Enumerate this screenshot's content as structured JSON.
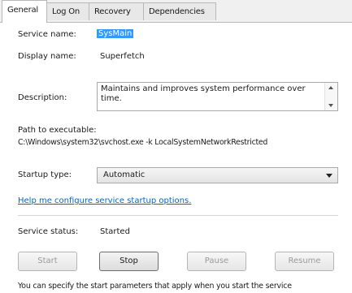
{
  "tabs": [
    "General",
    "Log On",
    "Recovery",
    "Dependencies"
  ],
  "service_name": {
    "label": "Service name:",
    "value": "SysMain"
  },
  "display_name": {
    "label": "Display name:",
    "value": "Superfetch"
  },
  "description": {
    "label": "Description:",
    "value": "Maintains and improves system performance over time."
  },
  "path": {
    "label": "Path to executable:",
    "value": "C:\\Windows\\system32\\svchost.exe -k LocalSystemNetworkRestricted"
  },
  "startup_type": {
    "label": "Startup type:",
    "value": "Automatic"
  },
  "help_link": "Help me configure service startup options.",
  "service_status": {
    "label": "Service status:",
    "value": "Started"
  },
  "buttons": {
    "start": "Start",
    "stop": "Stop",
    "pause": "Pause",
    "resume": "Resume"
  },
  "footer_text": "You can specify the start parameters that apply when you start the service"
}
